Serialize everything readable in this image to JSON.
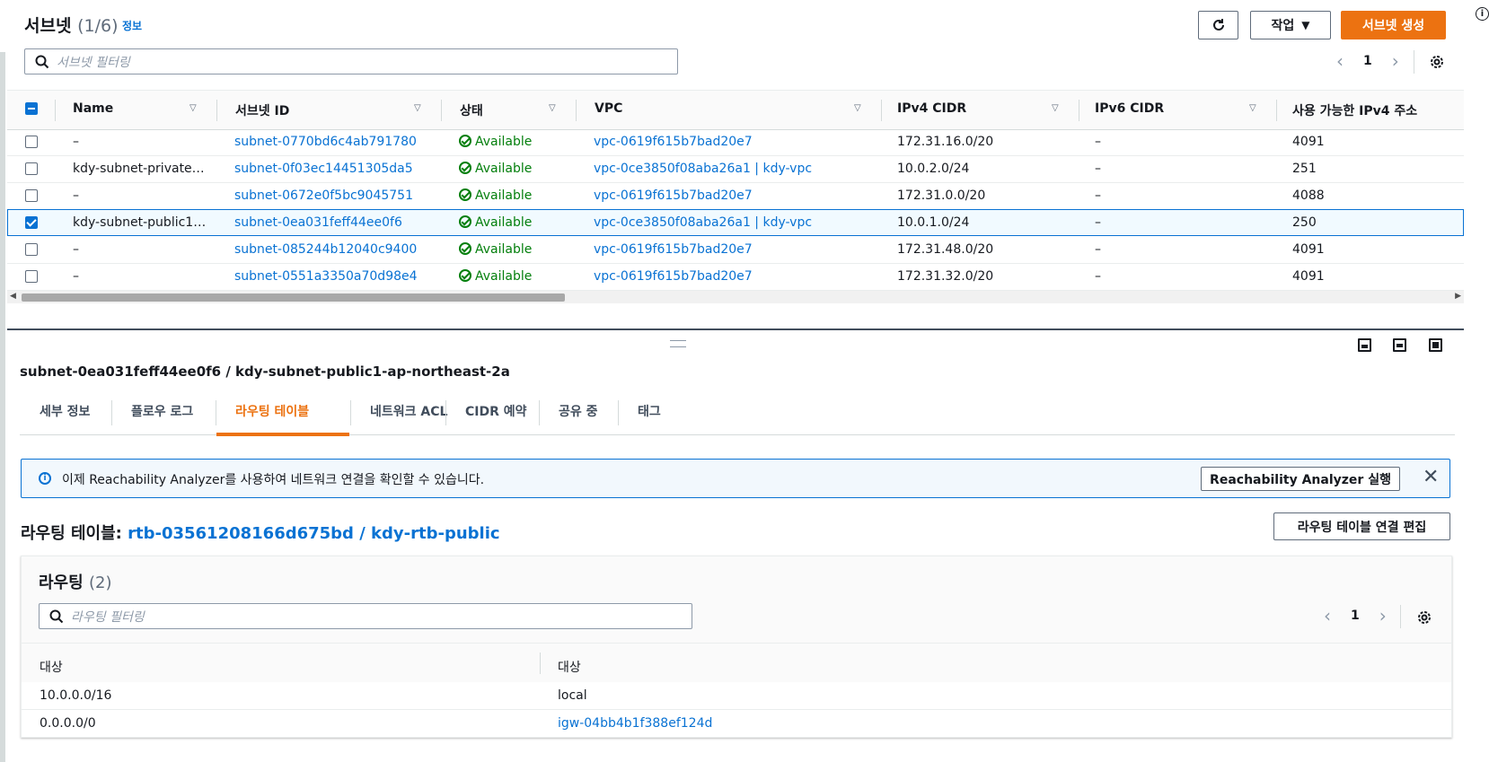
{
  "header": {
    "title": "서브넷",
    "count": "(1/6)",
    "info_label": "정보",
    "actions_label": "작업",
    "create_label": "서브넷 생성",
    "search_placeholder": "서브넷 필터링",
    "page": "1"
  },
  "table": {
    "columns": [
      "Name",
      "서브넷 ID",
      "상태",
      "VPC",
      "IPv4 CIDR",
      "IPv6 CIDR",
      "사용 가능한 IPv4 주소"
    ],
    "rows": [
      {
        "name": "–",
        "id": "subnet-0770bd6c4ab791780",
        "status": "Available",
        "vpc": "vpc-0619f615b7bad20e7",
        "ipv4": "172.31.16.0/20",
        "ipv6": "–",
        "avail": "4091",
        "selected": false
      },
      {
        "name": "kdy-subnet-private…",
        "id": "subnet-0f03ec14451305da5",
        "status": "Available",
        "vpc": "vpc-0ce3850f08aba26a1 | kdy-vpc",
        "ipv4": "10.0.2.0/24",
        "ipv6": "–",
        "avail": "251",
        "selected": false
      },
      {
        "name": "–",
        "id": "subnet-0672e0f5bc9045751",
        "status": "Available",
        "vpc": "vpc-0619f615b7bad20e7",
        "ipv4": "172.31.0.0/20",
        "ipv6": "–",
        "avail": "4088",
        "selected": false
      },
      {
        "name": "kdy-subnet-public1…",
        "id": "subnet-0ea031feff44ee0f6",
        "status": "Available",
        "vpc": "vpc-0ce3850f08aba26a1 | kdy-vpc",
        "ipv4": "10.0.1.0/24",
        "ipv6": "–",
        "avail": "250",
        "selected": true
      },
      {
        "name": "–",
        "id": "subnet-085244b12040c9400",
        "status": "Available",
        "vpc": "vpc-0619f615b7bad20e7",
        "ipv4": "172.31.48.0/20",
        "ipv6": "–",
        "avail": "4091",
        "selected": false
      },
      {
        "name": "–",
        "id": "subnet-0551a3350a70d98e4",
        "status": "Available",
        "vpc": "vpc-0619f615b7bad20e7",
        "ipv4": "172.31.32.0/20",
        "ipv6": "–",
        "avail": "4091",
        "selected": false
      }
    ]
  },
  "detail": {
    "title": "subnet-0ea031feff44ee0f6 / kdy-subnet-public1-ap-northeast-2a",
    "tabs": [
      "세부 정보",
      "플로우 로그",
      "라우팅 테이블",
      "네트워크 ACL",
      "CIDR 예약",
      "공유 중",
      "태그"
    ],
    "active_tab": "라우팅 테이블",
    "flash_text": "이제 Reachability Analyzer를 사용하여 네트워크 연결을 확인할 수 있습니다.",
    "flash_button": "Reachability Analyzer 실행",
    "rt_label": "라우팅 테이블:",
    "rt_link": "rtb-03561208166d675bd / kdy-rtb-public",
    "edit_button": "라우팅 테이블 연결 편집",
    "routes_title": "라우팅",
    "routes_count": "(2)",
    "routes_placeholder": "라우팅 필터링",
    "routes_page": "1",
    "routes_columns": [
      "대상",
      "대상"
    ],
    "routes": [
      {
        "dest": "10.0.0.0/16",
        "target": "local",
        "target_link": false
      },
      {
        "dest": "0.0.0.0/0",
        "target": "igw-04bb4b1f388ef124d",
        "target_link": true
      }
    ]
  },
  "colors": {
    "primary": "#ec7211",
    "link": "#0972d3",
    "success": "#037f0c"
  }
}
